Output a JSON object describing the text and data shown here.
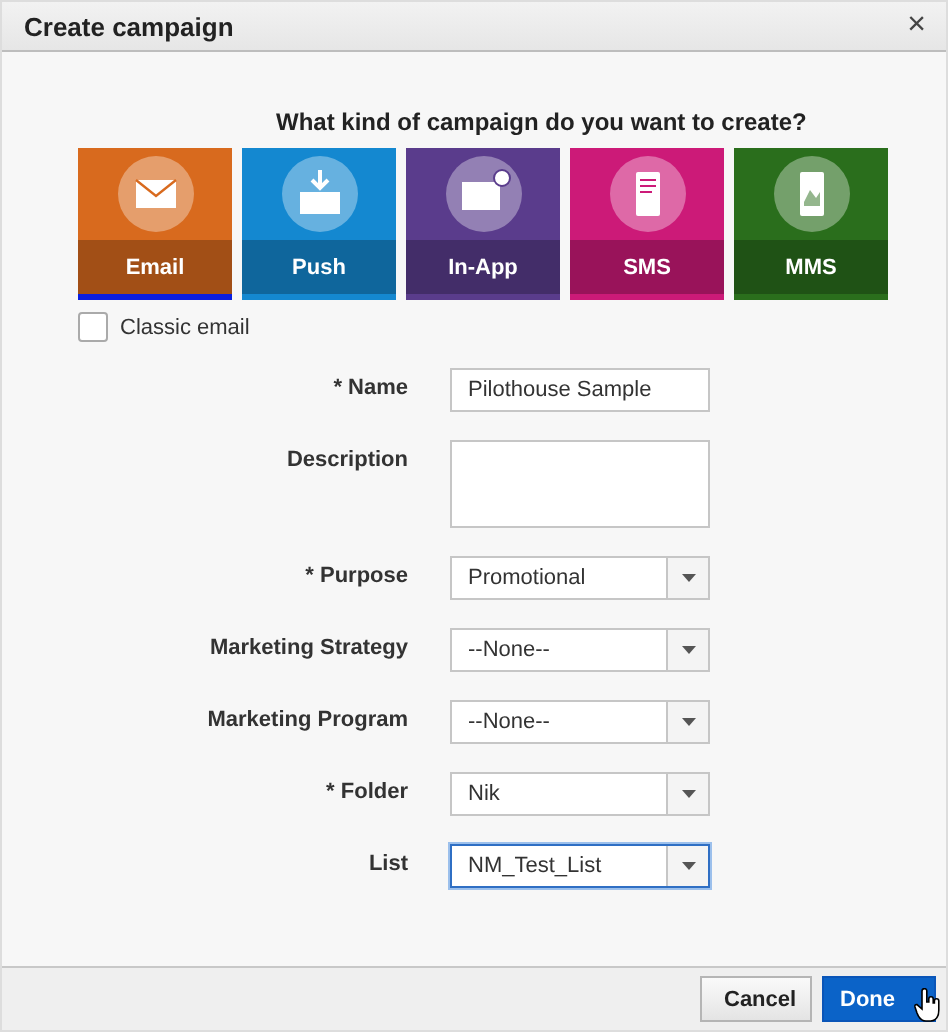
{
  "dialog": {
    "title": "Create campaign",
    "close": "×"
  },
  "question": "What kind of campaign do you want to create?",
  "campaign_types": [
    {
      "label": "Email",
      "kind": "email",
      "color": "#d86a1e",
      "selected": true
    },
    {
      "label": "Push",
      "kind": "push",
      "color": "#1488d0",
      "selected": false
    },
    {
      "label": "In-App",
      "kind": "inapp",
      "color": "#5a3c8c",
      "selected": false
    },
    {
      "label": "SMS",
      "kind": "sms",
      "color": "#cc1a78",
      "selected": false
    },
    {
      "label": "MMS",
      "kind": "mms",
      "color": "#2a6e1c",
      "selected": false
    }
  ],
  "classic_email": {
    "label": "Classic email",
    "checked": false
  },
  "fields": [
    {
      "label": "* Name",
      "kind": "text",
      "value": "Pilothouse Sample",
      "focused": false
    },
    {
      "label": "Description",
      "kind": "textarea",
      "focused": false
    },
    {
      "label": "* Purpose",
      "kind": "select",
      "value": "Promotional",
      "focused": false
    },
    {
      "label": "Marketing Strategy",
      "kind": "select",
      "value": "--None--",
      "focused": false
    },
    {
      "label": "Marketing Program",
      "kind": "select",
      "value": "--None--",
      "focused": false
    },
    {
      "label": "* Folder",
      "kind": "select",
      "value": "Nik",
      "focused": false
    },
    {
      "label": "List",
      "kind": "select",
      "value": "NM_Test_List",
      "focused": true
    }
  ],
  "buttons": [
    {
      "label": "Cancel",
      "primary": false
    },
    {
      "label": "Done",
      "primary": true
    }
  ]
}
